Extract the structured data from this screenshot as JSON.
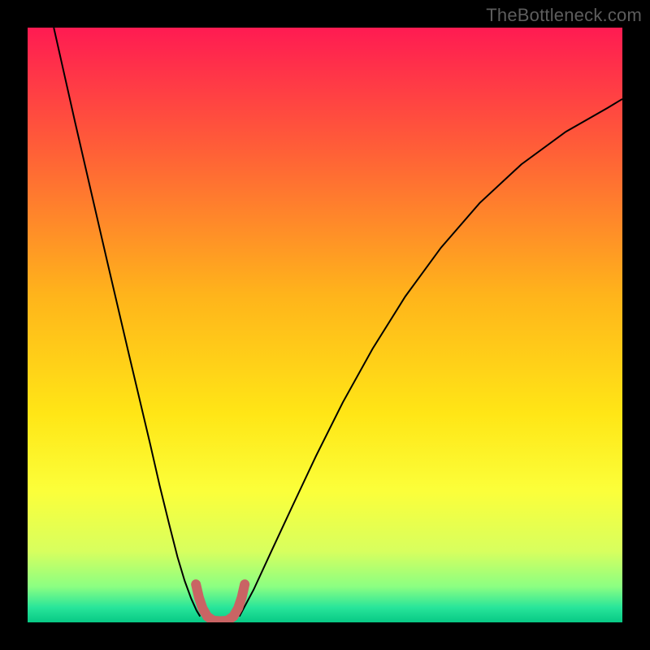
{
  "watermark": "TheBottleneck.com",
  "chart_data": {
    "type": "line",
    "title": "",
    "xlabel": "",
    "ylabel": "",
    "xlim": [
      0,
      1
    ],
    "ylim": [
      0,
      1
    ],
    "background_gradient": {
      "stops": [
        {
          "offset": 0.0,
          "color": "#ff1b52"
        },
        {
          "offset": 0.2,
          "color": "#ff5d38"
        },
        {
          "offset": 0.45,
          "color": "#ffb41b"
        },
        {
          "offset": 0.65,
          "color": "#ffe616"
        },
        {
          "offset": 0.78,
          "color": "#fbff3a"
        },
        {
          "offset": 0.88,
          "color": "#d8ff5e"
        },
        {
          "offset": 0.94,
          "color": "#8bff82"
        },
        {
          "offset": 0.975,
          "color": "#28e59a"
        },
        {
          "offset": 1.0,
          "color": "#07c985"
        }
      ]
    },
    "series": [
      {
        "name": "left-curve",
        "stroke": "#000000",
        "stroke_width": 2,
        "x": [
          0.044,
          0.062,
          0.08,
          0.098,
          0.116,
          0.134,
          0.152,
          0.17,
          0.188,
          0.206,
          0.222,
          0.238,
          0.252,
          0.264,
          0.275,
          0.284,
          0.29
        ],
        "y": [
          1.0,
          0.92,
          0.84,
          0.762,
          0.684,
          0.606,
          0.529,
          0.452,
          0.376,
          0.3,
          0.23,
          0.165,
          0.11,
          0.07,
          0.04,
          0.02,
          0.01
        ]
      },
      {
        "name": "right-curve",
        "stroke": "#000000",
        "stroke_width": 2,
        "x": [
          0.356,
          0.38,
          0.41,
          0.445,
          0.485,
          0.53,
          0.58,
          0.635,
          0.695,
          0.76,
          0.83,
          0.905,
          0.975,
          1.0
        ],
        "y": [
          0.01,
          0.055,
          0.12,
          0.195,
          0.28,
          0.37,
          0.46,
          0.548,
          0.63,
          0.705,
          0.77,
          0.825,
          0.865,
          0.88
        ]
      },
      {
        "name": "valley-marker",
        "stroke": "#c96464",
        "stroke_width": 12,
        "linecap": "round",
        "x": [
          0.283,
          0.288,
          0.294,
          0.302,
          0.312,
          0.324,
          0.336,
          0.346,
          0.354,
          0.36,
          0.365
        ],
        "y": [
          0.064,
          0.042,
          0.024,
          0.01,
          0.003,
          0.002,
          0.003,
          0.01,
          0.024,
          0.042,
          0.064
        ]
      }
    ]
  }
}
